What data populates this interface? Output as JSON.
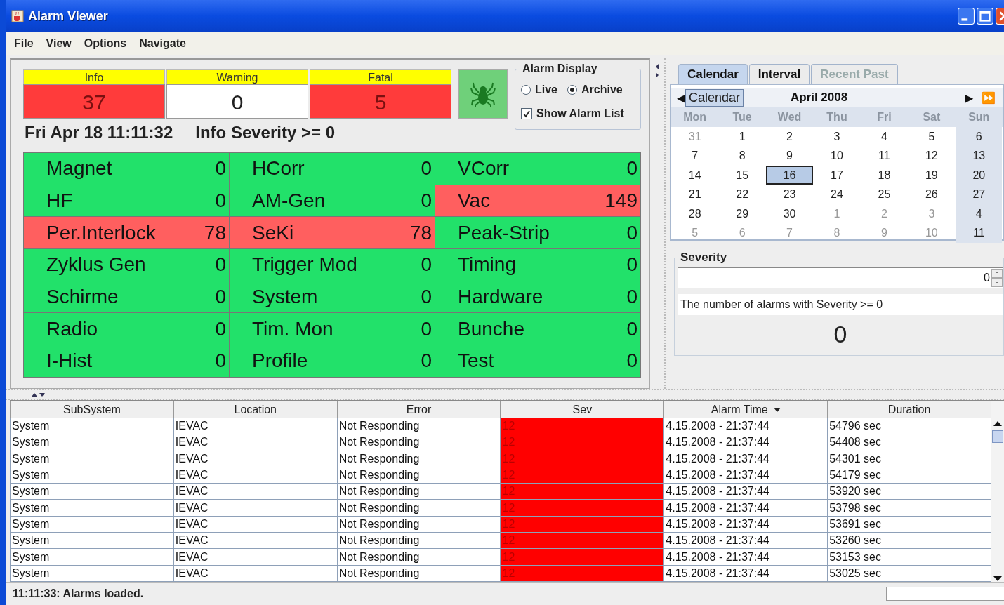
{
  "window": {
    "title": "Alarm Viewer"
  },
  "menu": [
    {
      "label": "File"
    },
    {
      "label": "View"
    },
    {
      "label": "Options"
    },
    {
      "label": "Navigate"
    }
  ],
  "counters": [
    {
      "label": "Info",
      "value": "37",
      "alarm": true
    },
    {
      "label": "Warning",
      "value": "0",
      "alarm": false
    },
    {
      "label": "Fatal",
      "value": "5",
      "alarm": true
    }
  ],
  "clock": "Fri Apr 18 11:11:32",
  "severity_filter": "Info Severity >= 0",
  "alarm_display": {
    "title": "Alarm Display",
    "modes": [
      {
        "label": "Live",
        "selected": false
      },
      {
        "label": "Archive",
        "selected": true
      }
    ],
    "show_list": {
      "label": "Show Alarm List",
      "checked": true
    }
  },
  "subsystems": [
    [
      {
        "name": "Magnet",
        "count": "0",
        "alarm": false
      },
      {
        "name": "HCorr",
        "count": "0",
        "alarm": false
      },
      {
        "name": "VCorr",
        "count": "0",
        "alarm": false
      }
    ],
    [
      {
        "name": "HF",
        "count": "0",
        "alarm": false
      },
      {
        "name": "AM-Gen",
        "count": "0",
        "alarm": false
      },
      {
        "name": "Vac",
        "count": "149",
        "alarm": true
      }
    ],
    [
      {
        "name": "Per.Interlock",
        "count": "78",
        "alarm": true
      },
      {
        "name": "SeKi",
        "count": "78",
        "alarm": true
      },
      {
        "name": "Peak-Strip",
        "count": "0",
        "alarm": false
      }
    ],
    [
      {
        "name": "Zyklus Gen",
        "count": "0",
        "alarm": false
      },
      {
        "name": "Trigger Mod",
        "count": "0",
        "alarm": false
      },
      {
        "name": "Timing",
        "count": "0",
        "alarm": false
      }
    ],
    [
      {
        "name": "Schirme",
        "count": "0",
        "alarm": false
      },
      {
        "name": "System",
        "count": "0",
        "alarm": false
      },
      {
        "name": "Hardware",
        "count": "0",
        "alarm": false
      }
    ],
    [
      {
        "name": "Radio",
        "count": "0",
        "alarm": false
      },
      {
        "name": "Tim. Mon",
        "count": "0",
        "alarm": false
      },
      {
        "name": "Bunche",
        "count": "0",
        "alarm": false
      }
    ],
    [
      {
        "name": "I-Hist",
        "count": "0",
        "alarm": false
      },
      {
        "name": "Profile",
        "count": "0",
        "alarm": false
      },
      {
        "name": "Test",
        "count": "0",
        "alarm": false
      }
    ]
  ],
  "tabs": [
    {
      "label": "Calendar",
      "selected": true,
      "disabled": false
    },
    {
      "label": "Interval",
      "selected": false,
      "disabled": false
    },
    {
      "label": "Recent Past",
      "selected": false,
      "disabled": true
    }
  ],
  "calendar": {
    "button": "Calendar",
    "month": "April 2008",
    "prev": "◀",
    "next": "▶",
    "next_fast": "⏩",
    "weekdays": [
      "Mon",
      "Tue",
      "Wed",
      "Thu",
      "Fri",
      "Sat",
      "Sun"
    ],
    "weeks": [
      [
        {
          "day": "31",
          "other": true,
          "selected": false
        },
        {
          "day": "1",
          "other": false,
          "selected": false
        },
        {
          "day": "2",
          "other": false,
          "selected": false
        },
        {
          "day": "3",
          "other": false,
          "selected": false
        },
        {
          "day": "4",
          "other": false,
          "selected": false
        },
        {
          "day": "5",
          "other": false,
          "selected": false
        },
        {
          "day": "6",
          "other": false,
          "selected": false
        }
      ],
      [
        {
          "day": "7",
          "other": false,
          "selected": false
        },
        {
          "day": "8",
          "other": false,
          "selected": false
        },
        {
          "day": "9",
          "other": false,
          "selected": false
        },
        {
          "day": "10",
          "other": false,
          "selected": false
        },
        {
          "day": "11",
          "other": false,
          "selected": false
        },
        {
          "day": "12",
          "other": false,
          "selected": false
        },
        {
          "day": "13",
          "other": false,
          "selected": false
        }
      ],
      [
        {
          "day": "14",
          "other": false,
          "selected": false
        },
        {
          "day": "15",
          "other": false,
          "selected": false
        },
        {
          "day": "16",
          "other": false,
          "selected": true
        },
        {
          "day": "17",
          "other": false,
          "selected": false
        },
        {
          "day": "18",
          "other": false,
          "selected": false
        },
        {
          "day": "19",
          "other": false,
          "selected": false
        },
        {
          "day": "20",
          "other": false,
          "selected": false
        }
      ],
      [
        {
          "day": "21",
          "other": false,
          "selected": false
        },
        {
          "day": "22",
          "other": false,
          "selected": false
        },
        {
          "day": "23",
          "other": false,
          "selected": false
        },
        {
          "day": "24",
          "other": false,
          "selected": false
        },
        {
          "day": "25",
          "other": false,
          "selected": false
        },
        {
          "day": "26",
          "other": false,
          "selected": false
        },
        {
          "day": "27",
          "other": false,
          "selected": false
        }
      ],
      [
        {
          "day": "28",
          "other": false,
          "selected": false
        },
        {
          "day": "29",
          "other": false,
          "selected": false
        },
        {
          "day": "30",
          "other": false,
          "selected": false
        },
        {
          "day": "1",
          "other": true,
          "selected": false
        },
        {
          "day": "2",
          "other": true,
          "selected": false
        },
        {
          "day": "3",
          "other": true,
          "selected": false
        },
        {
          "day": "4",
          "other": false,
          "selected": false
        }
      ],
      [
        {
          "day": "5",
          "other": true,
          "selected": false
        },
        {
          "day": "6",
          "other": true,
          "selected": false
        },
        {
          "day": "7",
          "other": true,
          "selected": false
        },
        {
          "day": "8",
          "other": true,
          "selected": false
        },
        {
          "day": "9",
          "other": true,
          "selected": false
        },
        {
          "day": "10",
          "other": true,
          "selected": false
        },
        {
          "day": "11",
          "other": false,
          "selected": false
        }
      ]
    ]
  },
  "severity": {
    "title": "Severity",
    "value": "0",
    "description": "The number of alarms with Severity >= 0",
    "count": "0"
  },
  "table": {
    "columns": [
      {
        "label": "SubSystem",
        "sorted": false
      },
      {
        "label": "Location",
        "sorted": false
      },
      {
        "label": "Error",
        "sorted": false
      },
      {
        "label": "Sev",
        "sorted": false
      },
      {
        "label": "Alarm Time",
        "sorted": true
      },
      {
        "label": "Duration",
        "sorted": false
      }
    ],
    "rows": [
      [
        "System",
        "IEVAC",
        "Not Responding",
        "12",
        "4.15.2008 - 21:37:44",
        "54796 sec"
      ],
      [
        "System",
        "IEVAC",
        "Not Responding",
        "12",
        "4.15.2008 - 21:37:44",
        "54408 sec"
      ],
      [
        "System",
        "IEVAC",
        "Not Responding",
        "12",
        "4.15.2008 - 21:37:44",
        "54301 sec"
      ],
      [
        "System",
        "IEVAC",
        "Not Responding",
        "12",
        "4.15.2008 - 21:37:44",
        "54179 sec"
      ],
      [
        "System",
        "IEVAC",
        "Not Responding",
        "12",
        "4.15.2008 - 21:37:44",
        "53920 sec"
      ],
      [
        "System",
        "IEVAC",
        "Not Responding",
        "12",
        "4.15.2008 - 21:37:44",
        "53798 sec"
      ],
      [
        "System",
        "IEVAC",
        "Not Responding",
        "12",
        "4.15.2008 - 21:37:44",
        "53691 sec"
      ],
      [
        "System",
        "IEVAC",
        "Not Responding",
        "12",
        "4.15.2008 - 21:37:44",
        "53260 sec"
      ],
      [
        "System",
        "IEVAC",
        "Not Responding",
        "12",
        "4.15.2008 - 21:37:44",
        "53153 sec"
      ],
      [
        "System",
        "IEVAC",
        "Not Responding",
        "12",
        "4.15.2008 - 21:37:44",
        "53025 sec"
      ]
    ]
  },
  "status_bar": "11:11:33: Alarms loaded."
}
